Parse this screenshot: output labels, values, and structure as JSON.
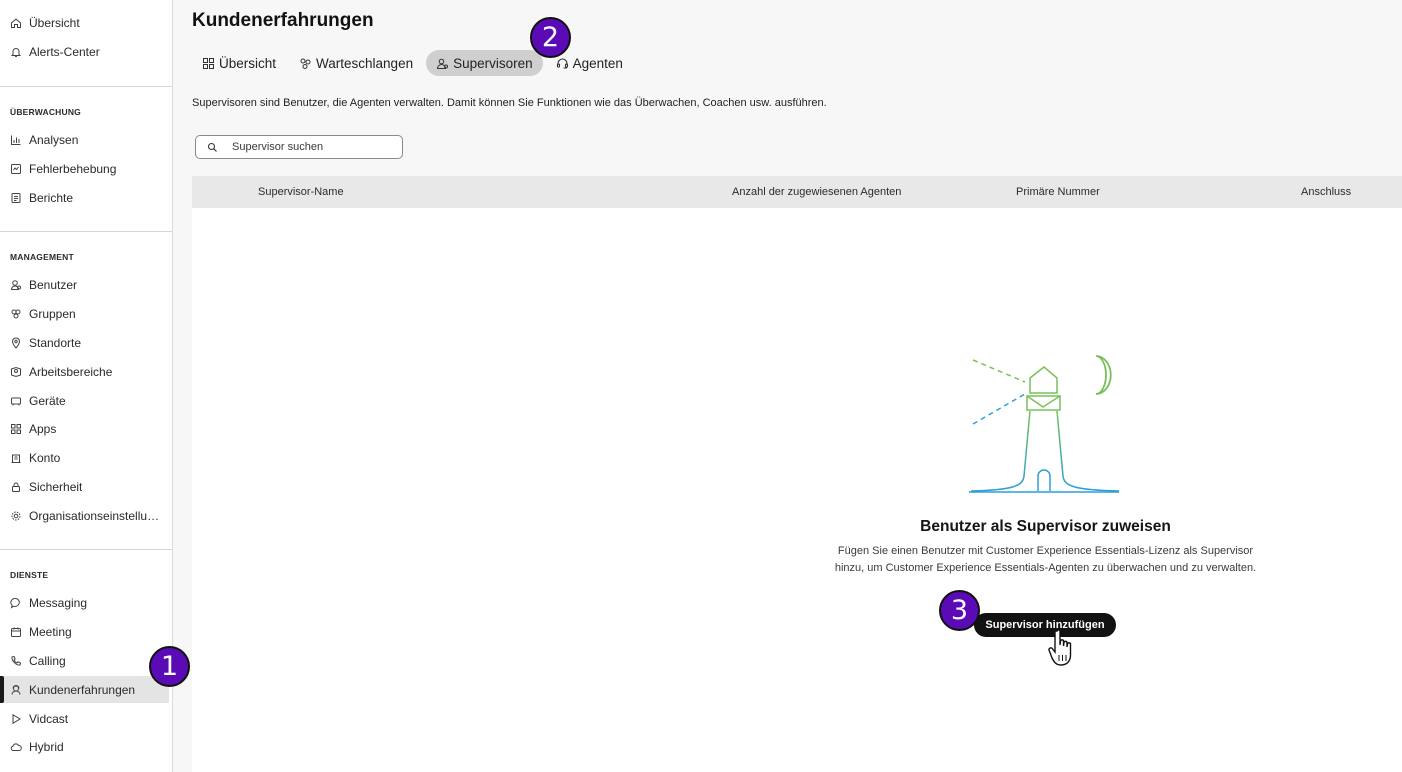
{
  "sidebar": {
    "top_items": [
      {
        "label": "Übersicht",
        "icon": "home-icon"
      },
      {
        "label": "Alerts-Center",
        "icon": "bell-icon"
      }
    ],
    "sections": [
      {
        "heading": "ÜBERWACHUNG",
        "items": [
          {
            "label": "Analysen",
            "icon": "chart-icon"
          },
          {
            "label": "Fehlerbehebung",
            "icon": "troubleshoot-icon"
          },
          {
            "label": "Berichte",
            "icon": "report-icon"
          }
        ]
      },
      {
        "heading": "MANAGEMENT",
        "items": [
          {
            "label": "Benutzer",
            "icon": "user-icon"
          },
          {
            "label": "Gruppen",
            "icon": "group-icon"
          },
          {
            "label": "Standorte",
            "icon": "location-icon"
          },
          {
            "label": "Arbeitsbereiche",
            "icon": "workspace-icon"
          },
          {
            "label": "Geräte",
            "icon": "device-icon"
          },
          {
            "label": "Apps",
            "icon": "apps-icon"
          },
          {
            "label": "Konto",
            "icon": "account-icon"
          },
          {
            "label": "Sicherheit",
            "icon": "lock-icon"
          },
          {
            "label": "Organisationseinstellungen",
            "icon": "gear-icon"
          }
        ]
      },
      {
        "heading": "DIENSTE",
        "items": [
          {
            "label": "Messaging",
            "icon": "chat-icon"
          },
          {
            "label": "Meeting",
            "icon": "calendar-icon"
          },
          {
            "label": "Calling",
            "icon": "phone-icon"
          },
          {
            "label": "Kundenerfahrungen",
            "icon": "customer-experience-icon",
            "active": true
          },
          {
            "label": "Vidcast",
            "icon": "play-icon"
          },
          {
            "label": "Hybrid",
            "icon": "cloud-icon"
          }
        ]
      }
    ]
  },
  "main": {
    "title": "Kundenerfahrungen",
    "tabs": [
      {
        "label": "Übersicht",
        "icon": "grid-icon"
      },
      {
        "label": "Warteschlangen",
        "icon": "queue-icon"
      },
      {
        "label": "Supervisoren",
        "icon": "supervisor-icon",
        "active": true
      },
      {
        "label": "Agenten",
        "icon": "headset-icon"
      }
    ],
    "description": "Supervisoren sind Benutzer, die Agenten verwalten. Damit können Sie Funktionen wie das Überwachen, Coachen usw. ausführen.",
    "search": {
      "placeholder": "Supervisor suchen",
      "value": ""
    },
    "table": {
      "columns": [
        "Supervisor-Name",
        "Anzahl der zugewiesenen Agenten",
        "Primäre Nummer",
        "Anschluss"
      ]
    },
    "empty_state": {
      "title": "Benutzer als Supervisor zuweisen",
      "text": "Fügen Sie einen Benutzer mit Customer Experience Essentials-Lizenz als Supervisor hinzu, um Customer Experience Essentials-Agenten zu überwachen und zu verwalten.",
      "button_label": "Supervisor hinzufügen"
    }
  },
  "annotations": {
    "step1": "1",
    "step2": "2",
    "step3": "3",
    "color": "#5b0bb5"
  },
  "colors": {
    "illustration_green": "#79c05a",
    "illustration_blue": "#2d9fd8",
    "active_tab_bg": "#cfcfcf",
    "button_bg": "#121212"
  }
}
